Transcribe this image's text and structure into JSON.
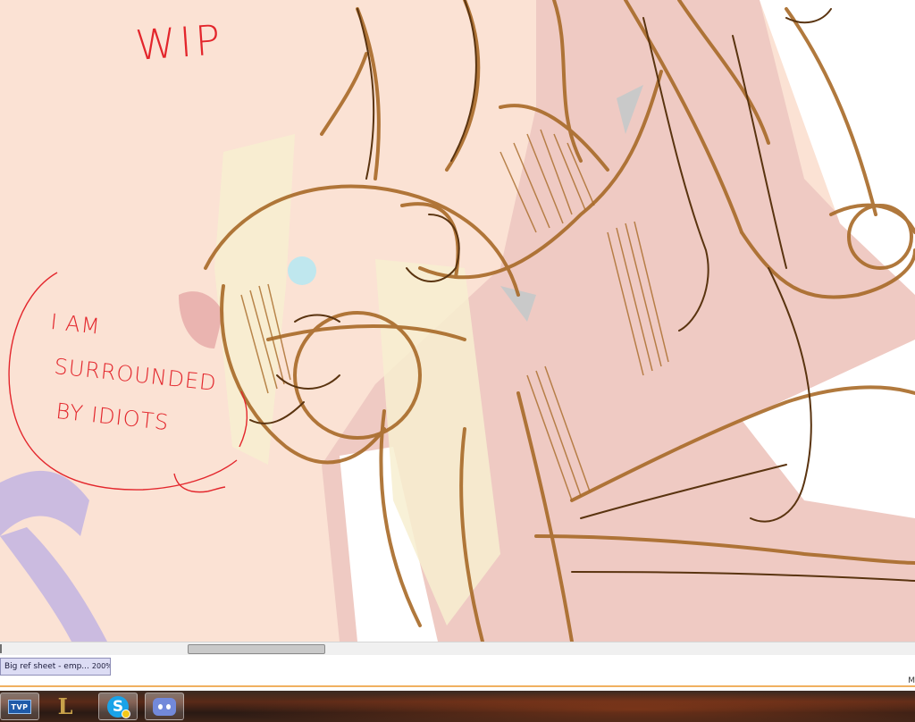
{
  "canvas": {
    "handwriting": {
      "title": "WIP",
      "speech_line_1": "I AM",
      "speech_line_2": "SURROUNDED",
      "speech_line_3": "BY IDIOTS"
    },
    "colors": {
      "background": "#fbe2d4",
      "sketch_brown": "#a86a28",
      "dark_lineart": "#5a3410",
      "annotation_red": "#e3262c"
    }
  },
  "document_tab": {
    "label": "Big ref sheet - emp...",
    "zoom": "200%"
  },
  "status_corner": "M",
  "taskbar": {
    "tvp_label": "TVP",
    "lol_glyph": "L",
    "skype_glyph": "S",
    "icons": [
      "tvpaint-icon",
      "league-of-legends-icon",
      "skype-icon",
      "discord-icon"
    ]
  }
}
